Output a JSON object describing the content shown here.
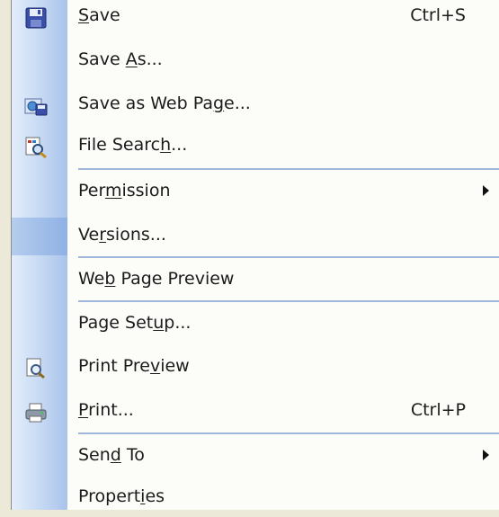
{
  "menu": {
    "items": [
      {
        "id": "save",
        "label_parts": [
          "",
          "S",
          "ave"
        ],
        "shortcut": "Ctrl+S",
        "icon": "floppy-disk-icon"
      },
      {
        "id": "save-as",
        "label_parts": [
          "Save ",
          "A",
          "s..."
        ],
        "shortcut": "",
        "icon": ""
      },
      {
        "id": "save-web",
        "label_parts": [
          "Save as Web Pa",
          "g",
          "e..."
        ],
        "shortcut": "",
        "icon": "save-web-page-icon"
      },
      {
        "id": "file-search",
        "label_parts": [
          "File Searc",
          "h",
          "..."
        ],
        "shortcut": "",
        "icon": "file-search-icon"
      },
      {
        "id": "permission",
        "label_parts": [
          "Per",
          "m",
          "ission"
        ],
        "shortcut": "",
        "submenu": true
      },
      {
        "id": "versions",
        "label_parts": [
          "Ve",
          "r",
          "sions..."
        ],
        "shortcut": ""
      },
      {
        "id": "web-preview",
        "label_parts": [
          "We",
          "b",
          " Page Preview"
        ],
        "shortcut": ""
      },
      {
        "id": "page-setup",
        "label_parts": [
          "Page Set",
          "u",
          "p..."
        ],
        "shortcut": ""
      },
      {
        "id": "print-preview",
        "label_parts": [
          "Print Pre",
          "v",
          "iew"
        ],
        "shortcut": "",
        "icon": "print-preview-icon"
      },
      {
        "id": "print",
        "label_parts": [
          "",
          "P",
          "rint..."
        ],
        "shortcut": "Ctrl+P",
        "icon": "printer-icon"
      },
      {
        "id": "send-to",
        "label_parts": [
          "Sen",
          "d",
          " To"
        ],
        "shortcut": "",
        "submenu": true
      },
      {
        "id": "properties",
        "label_parts": [
          "Propert",
          "i",
          "es"
        ],
        "shortcut": ""
      }
    ]
  },
  "colors": {
    "menu_bg": "#fcfcf9",
    "gutter_accent": "#a9c3ea",
    "separator": "#9eb6d8"
  }
}
